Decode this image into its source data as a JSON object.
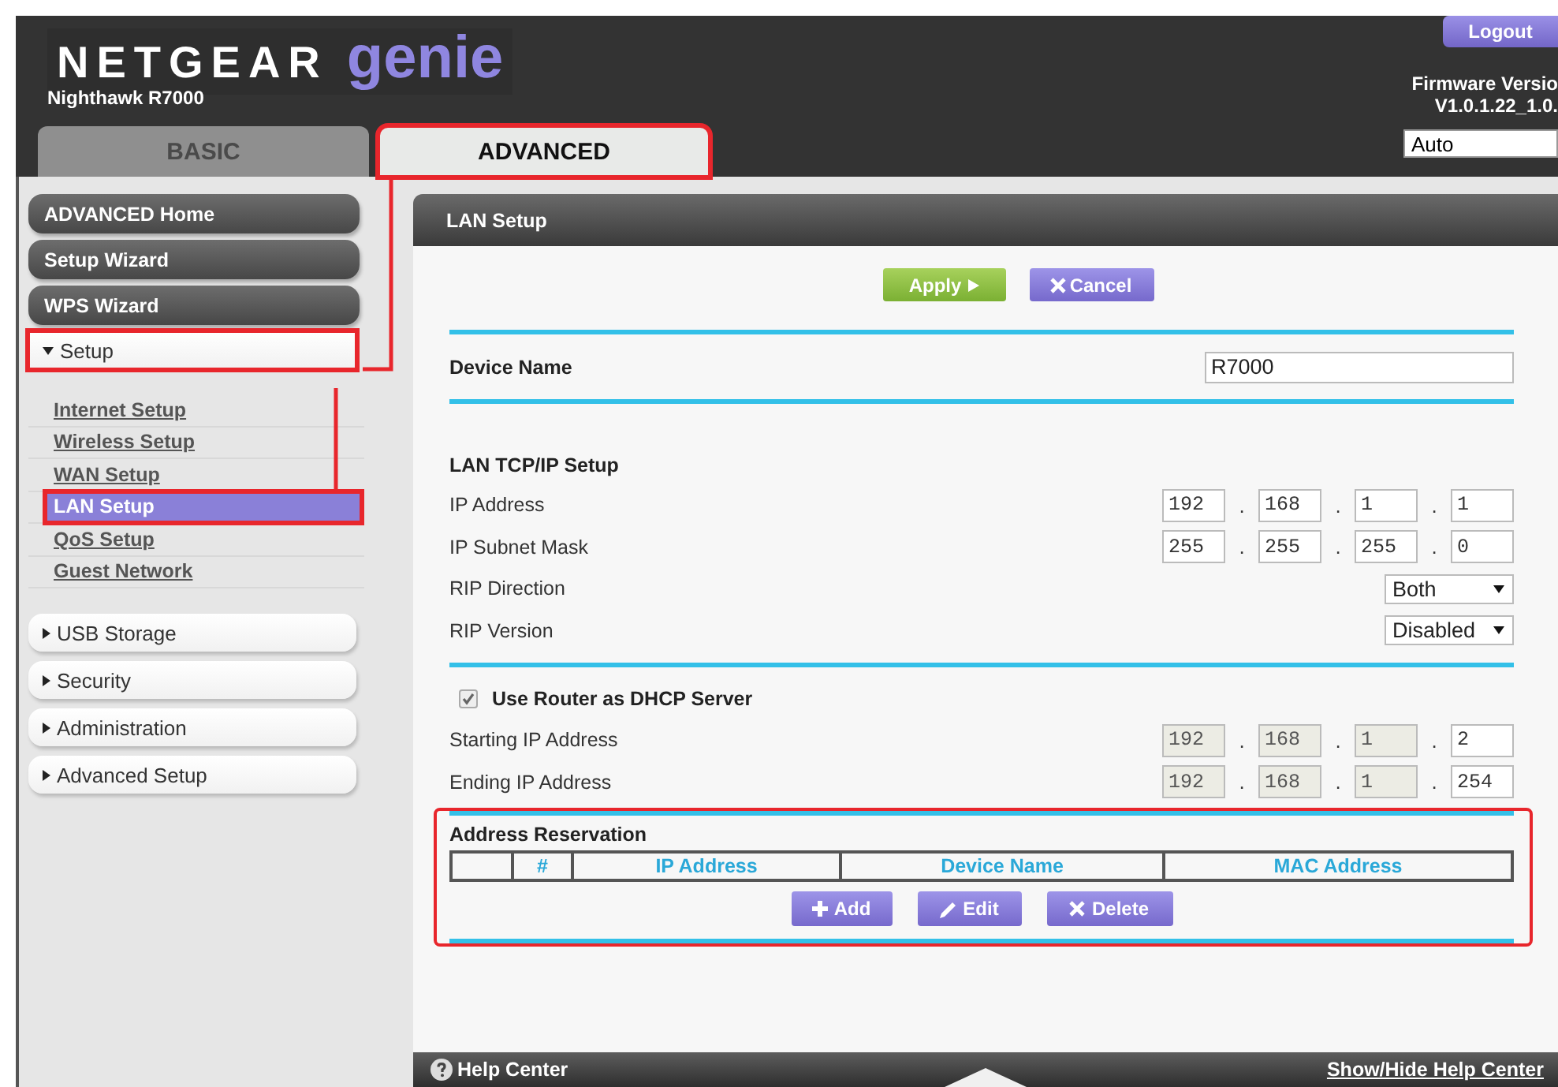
{
  "header": {
    "brand": "NETGEAR",
    "product": "genie",
    "model": "Nighthawk R7000",
    "logout": "Logout",
    "firmware_label": "Firmware Versio",
    "firmware_version": "V1.0.1.22_1.0.",
    "language": "Auto"
  },
  "tabs": [
    {
      "label": "BASIC",
      "selected": false,
      "highlighted": false
    },
    {
      "label": "ADVANCED",
      "selected": true,
      "highlighted": true
    }
  ],
  "sidebar": {
    "items": [
      {
        "kind": "button",
        "label": "ADVANCED Home"
      },
      {
        "kind": "button",
        "label": "Setup Wizard"
      },
      {
        "kind": "button",
        "label": "WPS Wizard"
      },
      {
        "kind": "section",
        "label": "Setup",
        "expanded": true,
        "highlighted": true,
        "children": [
          {
            "label": "Internet Setup",
            "selected": false,
            "highlighted": false
          },
          {
            "label": "Wireless Setup",
            "selected": false,
            "highlighted": false
          },
          {
            "label": "WAN Setup",
            "selected": false,
            "highlighted": false
          },
          {
            "label": "LAN Setup",
            "selected": true,
            "highlighted": true
          },
          {
            "label": "QoS Setup",
            "selected": false,
            "highlighted": false
          },
          {
            "label": "Guest Network",
            "selected": false,
            "highlighted": false
          }
        ]
      },
      {
        "kind": "section",
        "label": "USB Storage",
        "expanded": false,
        "highlighted": false
      },
      {
        "kind": "section",
        "label": "Security",
        "expanded": false,
        "highlighted": false
      },
      {
        "kind": "section",
        "label": "Administration",
        "expanded": false,
        "highlighted": false
      },
      {
        "kind": "section",
        "label": "Advanced Setup",
        "expanded": false,
        "highlighted": false
      }
    ]
  },
  "panel": {
    "title": "LAN Setup",
    "actions": [
      {
        "kind": "apply",
        "label": "Apply"
      },
      {
        "kind": "cancel",
        "label": "Cancel"
      }
    ],
    "device_name": {
      "label": "Device Name",
      "value": "R7000"
    },
    "lan_tcpip": {
      "title": "LAN TCP/IP Setup",
      "fields": [
        {
          "kind": "ip",
          "label": "IP Address",
          "separator": ".",
          "octets": [
            {
              "value": "192",
              "disabled": false
            },
            {
              "value": "168",
              "disabled": false
            },
            {
              "value": "1",
              "disabled": false
            },
            {
              "value": "1",
              "disabled": false
            }
          ]
        },
        {
          "kind": "ip",
          "label": "IP Subnet Mask",
          "separator": ".",
          "octets": [
            {
              "value": "255",
              "disabled": false
            },
            {
              "value": "255",
              "disabled": false
            },
            {
              "value": "255",
              "disabled": false
            },
            {
              "value": "0",
              "disabled": false
            }
          ]
        },
        {
          "kind": "select",
          "label": "RIP Direction",
          "value": "Both"
        },
        {
          "kind": "select",
          "label": "RIP Version",
          "value": "Disabled"
        }
      ]
    },
    "dhcp": {
      "label": "Use Router as DHCP Server",
      "checked": true,
      "fields": [
        {
          "kind": "ip",
          "label": "Starting IP Address",
          "separator": ".",
          "octets": [
            {
              "value": "192",
              "disabled": true
            },
            {
              "value": "168",
              "disabled": true
            },
            {
              "value": "1",
              "disabled": true
            },
            {
              "value": "2",
              "disabled": false
            }
          ]
        },
        {
          "kind": "ip",
          "label": "Ending IP Address",
          "separator": ".",
          "octets": [
            {
              "value": "192",
              "disabled": true
            },
            {
              "value": "168",
              "disabled": true
            },
            {
              "value": "1",
              "disabled": true
            },
            {
              "value": "254",
              "disabled": false
            }
          ]
        }
      ]
    },
    "reservation": {
      "title": "Address Reservation",
      "highlighted": true,
      "columns": [
        "#",
        "IP Address",
        "Device Name",
        "MAC Address"
      ],
      "buttons": [
        {
          "kind": "add",
          "label": "Add"
        },
        {
          "kind": "edit",
          "label": "Edit"
        },
        {
          "kind": "delete",
          "label": "Delete"
        }
      ]
    }
  },
  "footer": {
    "help": "Help Center",
    "toggle": "Show/Hide Help Center"
  },
  "annotation": {
    "connectors": true
  }
}
